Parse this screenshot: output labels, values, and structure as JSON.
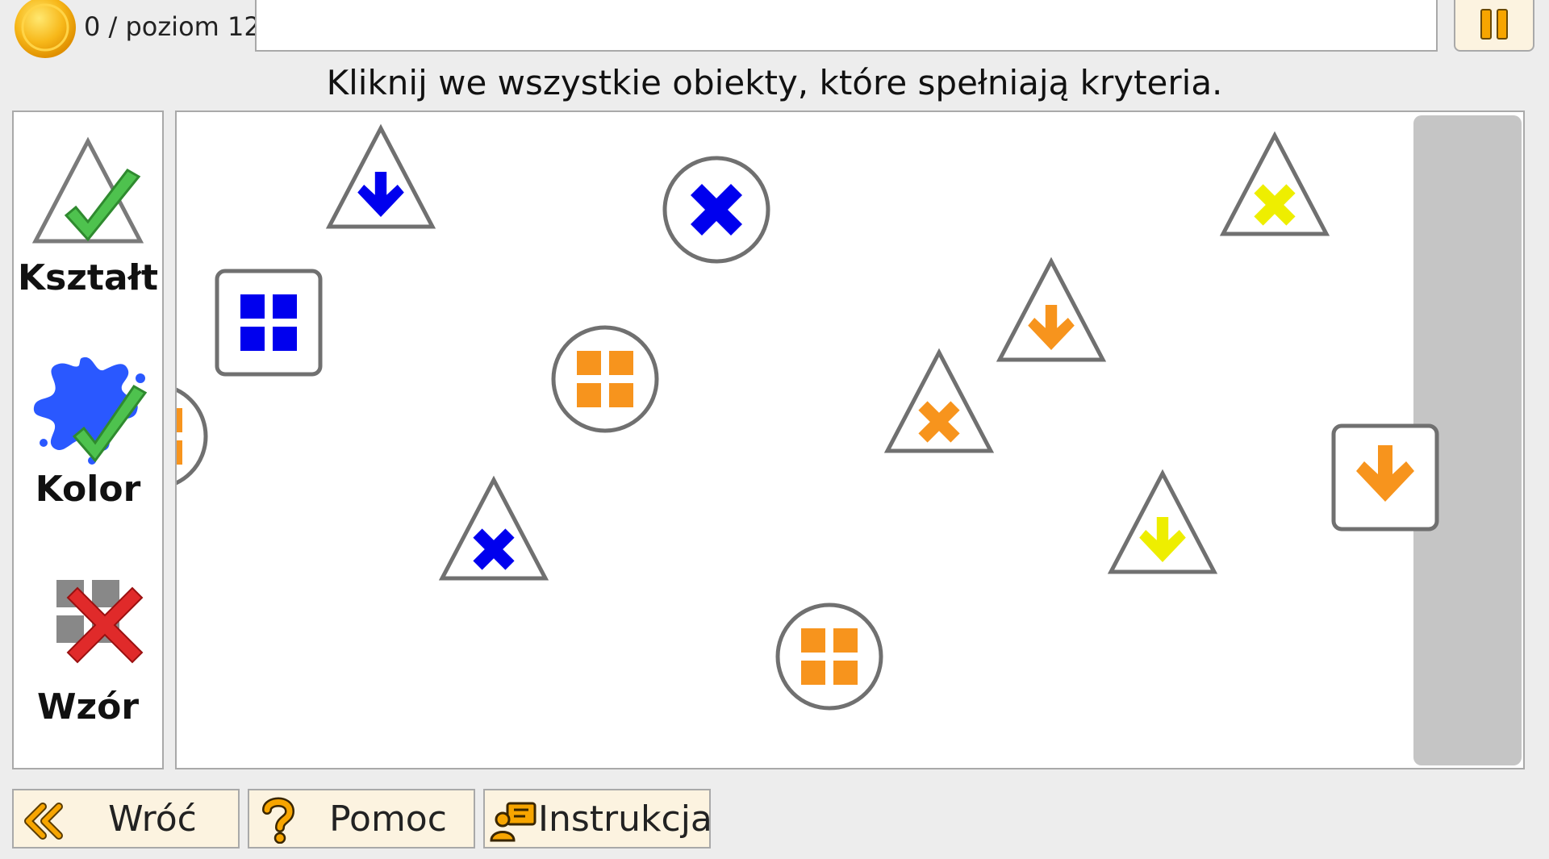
{
  "header": {
    "score": "0",
    "separator": "/",
    "level_text": "poziom 12"
  },
  "instruction": "Kliknij we wszystkie obiekty, które spełniają kryteria.",
  "criteria": [
    {
      "label": "Kształt",
      "icon": "triangle-check-icon",
      "status": "check"
    },
    {
      "label": "Kolor",
      "icon": "paint-splash-check-icon",
      "status": "check"
    },
    {
      "label": "Wzór",
      "icon": "pattern-cross-icon",
      "status": "cross"
    }
  ],
  "objects": [
    {
      "shape": "triangle",
      "pattern": "arrow",
      "color": "blue"
    },
    {
      "shape": "circle",
      "pattern": "cross",
      "color": "blue"
    },
    {
      "shape": "triangle",
      "pattern": "cross",
      "color": "yellow"
    },
    {
      "shape": "square",
      "pattern": "grid",
      "color": "blue"
    },
    {
      "shape": "triangle",
      "pattern": "arrow",
      "color": "orange"
    },
    {
      "shape": "circle",
      "pattern": "grid",
      "color": "orange"
    },
    {
      "shape": "circle",
      "pattern": "grid",
      "color": "orange",
      "note": "partially visible"
    },
    {
      "shape": "triangle",
      "pattern": "cross",
      "color": "orange"
    },
    {
      "shape": "square",
      "pattern": "arrow",
      "color": "orange"
    },
    {
      "shape": "triangle",
      "pattern": "cross",
      "color": "blue"
    },
    {
      "shape": "triangle",
      "pattern": "arrow",
      "color": "yellow"
    },
    {
      "shape": "circle",
      "pattern": "grid",
      "color": "orange"
    }
  ],
  "colors": {
    "blue": "#0000ee",
    "orange": "#f7941d",
    "yellow": "#eeee00",
    "button_bg": "#fcf3e0",
    "icon_orange": "#f7a500"
  },
  "footer": {
    "back_label": "Wróć",
    "help_label": "Pomoc",
    "instructions_label": "Instrukcja"
  }
}
